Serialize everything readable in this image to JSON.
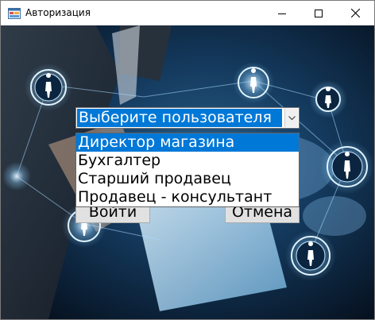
{
  "window": {
    "title": "Авторизация",
    "controls": {
      "minimize": "minimize-icon",
      "maximize": "maximize-icon",
      "close": "close-icon"
    }
  },
  "form": {
    "user_combo": {
      "selected_text": "Выберите пользователя",
      "options": [
        "Директор магазина",
        "Бухгалтер",
        "Старший продавец",
        "Продавец - консультант"
      ],
      "highlighted_index": 0
    },
    "login_button": "Войти",
    "cancel_button": "Отмена"
  },
  "colors": {
    "selection": "#0078d7",
    "background": "#0b1d33",
    "glow": "#9fd8ff"
  }
}
